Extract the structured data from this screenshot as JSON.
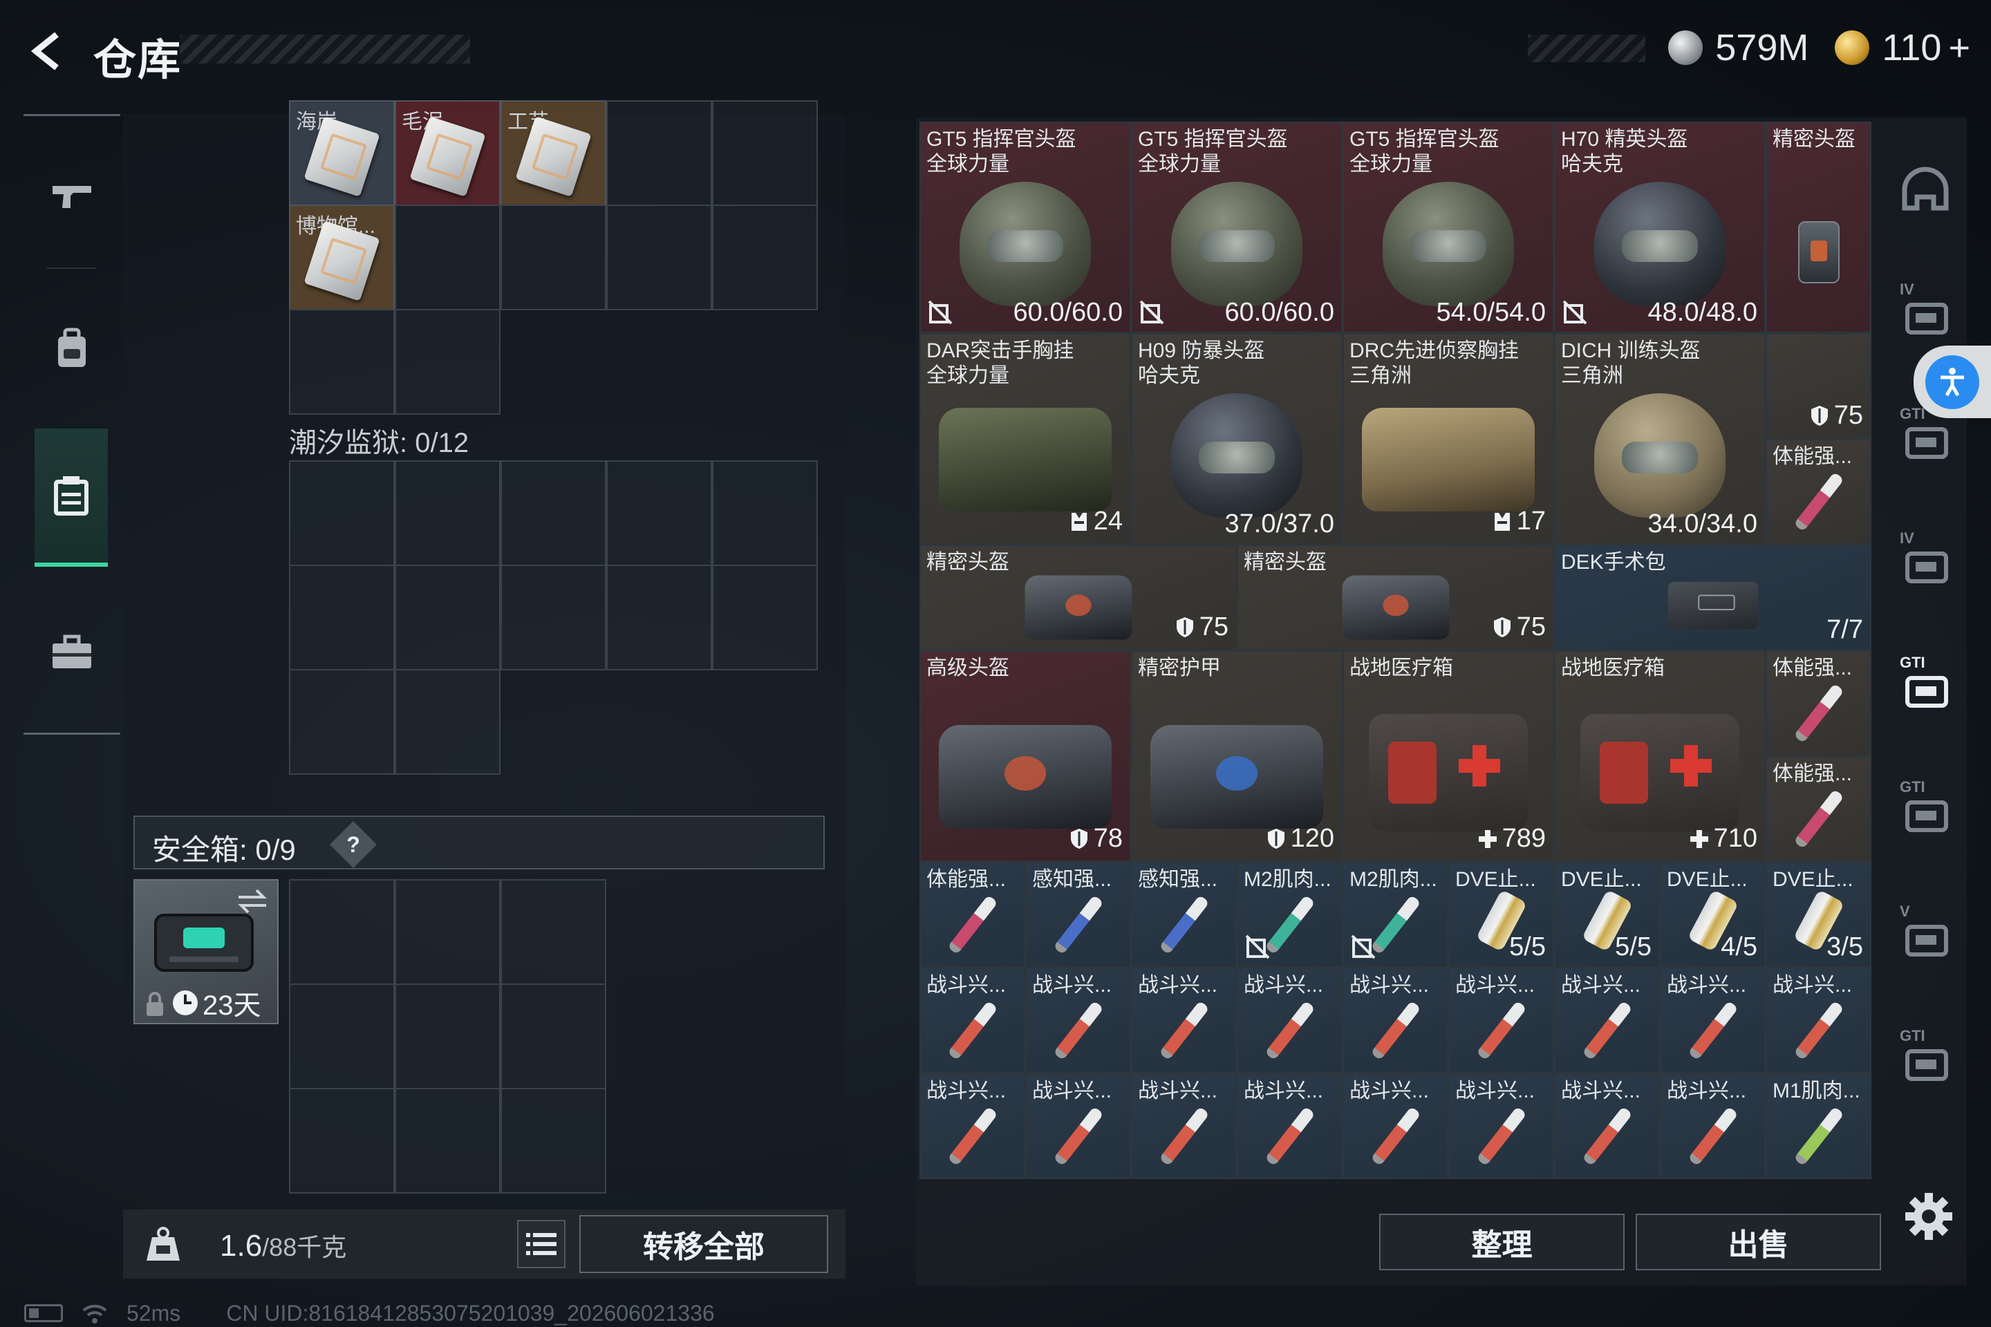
{
  "header": {
    "title": "仓库",
    "currency_silver": "579M",
    "currency_gold": "110",
    "currency_add": "+"
  },
  "left_nav": {
    "items": [
      {
        "name": "weapons",
        "icon": "pistol-icon"
      },
      {
        "name": "equipment",
        "icon": "backpack-icon"
      },
      {
        "name": "storage",
        "icon": "crate-icon",
        "active": true
      },
      {
        "name": "briefcase",
        "icon": "briefcase-icon"
      }
    ]
  },
  "storage": {
    "top_items": [
      {
        "label": "海岸..."
      },
      {
        "label": "毛泥..."
      },
      {
        "label": "工艺..."
      }
    ],
    "museum_item": {
      "label": "博物馆..."
    },
    "prison_label": "潮汐监狱: 0/12"
  },
  "safe_box": {
    "label": "安全箱:  0/9",
    "help": "?",
    "days": "23天"
  },
  "bottom_left": {
    "weight": "1.6",
    "weight_max": "/88千克",
    "transfer_all": "转移全部"
  },
  "inventory": {
    "items": [
      {
        "name": "GT5 指挥官头盔\n全球力量",
        "value": "60.0/60.0",
        "bg": "red",
        "art": "helmet",
        "noicon": true
      },
      {
        "name": "GT5 指挥官头盔\n全球力量",
        "value": "60.0/60.0",
        "bg": "red",
        "art": "helmet",
        "noicon": true
      },
      {
        "name": "GT5 指挥官头盔\n全球力量",
        "value": "54.0/54.0",
        "bg": "red",
        "art": "helmet"
      },
      {
        "name": "H70 精英头盔\n哈夫克",
        "value": "48.0/48.0",
        "bg": "red",
        "art": "helmet dark",
        "noicon": true
      },
      {
        "name": "精密头盔",
        "value": "",
        "bg": "red",
        "art": "vial"
      },
      {
        "name": "DAR突击手胸挂\n全球力量",
        "value": "24",
        "bg": "gray",
        "art": "bag",
        "glyph": "vest"
      },
      {
        "name": "H09 防暴头盔\n哈夫克",
        "value": "37.0/37.0",
        "bg": "gray",
        "art": "helmet dark"
      },
      {
        "name": "DRC先进侦察胸挂\n三角洲",
        "value": "17",
        "bg": "gray",
        "art": "bag tan",
        "glyph": "vest"
      },
      {
        "name": "DICH 训练头盔\n三角洲",
        "value": "34.0/34.0",
        "bg": "gray",
        "art": "helmet tan"
      },
      {
        "name": "",
        "value": "75",
        "bg": "gray",
        "art": "",
        "glyph": "shield"
      },
      {
        "name": "体能强...",
        "value": "",
        "bg": "gray",
        "art": "syringe",
        "sc": "#c84a6e"
      },
      {
        "name": "精密头盔",
        "value": "75",
        "bg": "gray",
        "art": "bag dark",
        "glyph": "shield"
      },
      {
        "name": "精密头盔",
        "value": "75",
        "bg": "gray",
        "art": "bag dark",
        "glyph": "shield"
      },
      {
        "name": "DEK手术包",
        "value": "7/7",
        "bg": "blue",
        "art": "pouch"
      },
      {
        "name": "高级头盔",
        "value": "78",
        "bg": "red",
        "art": "bag dark",
        "glyph": "shield"
      },
      {
        "name": "精密护甲",
        "value": "120",
        "bg": "gray",
        "art": "bag dark blue",
        "glyph": "shield"
      },
      {
        "name": "战地医疗箱",
        "value": "789",
        "bg": "gray",
        "art": "medkit",
        "glyph": "plus"
      },
      {
        "name": "战地医疗箱",
        "value": "710",
        "bg": "gray",
        "art": "medkit",
        "glyph": "plus"
      },
      {
        "name": "体能强...",
        "value": "",
        "bg": "gray",
        "art": "syringe",
        "sc": "#c84a6e"
      },
      {
        "name": "体能强...",
        "value": "",
        "bg": "gray",
        "art": "syringe",
        "sc": "#c84a6e"
      },
      {
        "name": "体能强...",
        "value": "",
        "bg": "blue",
        "art": "syringe",
        "sc": "#c84a6e"
      },
      {
        "name": "感知强...",
        "value": "",
        "bg": "blue",
        "art": "syringe",
        "sc": "#4a6ec8"
      },
      {
        "name": "感知强...",
        "value": "",
        "bg": "blue",
        "art": "syringe",
        "sc": "#4a6ec8"
      },
      {
        "name": "M2肌肉...",
        "value": "",
        "bg": "blue",
        "art": "syringe",
        "sc": "#3fb39a",
        "noicon": true
      },
      {
        "name": "M2肌肉...",
        "value": "",
        "bg": "blue",
        "art": "syringe",
        "sc": "#3fb39a",
        "noicon": true
      },
      {
        "name": "DVE止...",
        "value": "5/5",
        "bg": "blue",
        "art": "can"
      },
      {
        "name": "DVE止...",
        "value": "5/5",
        "bg": "blue",
        "art": "can"
      },
      {
        "name": "DVE止...",
        "value": "4/5",
        "bg": "blue",
        "art": "can"
      },
      {
        "name": "DVE止...",
        "value": "3/5",
        "bg": "blue",
        "art": "can"
      },
      {
        "name": "战斗兴...",
        "value": "",
        "bg": "blue",
        "art": "syringe",
        "sc": "#d65b4a"
      },
      {
        "name": "战斗兴...",
        "value": "",
        "bg": "blue",
        "art": "syringe",
        "sc": "#d65b4a"
      },
      {
        "name": "战斗兴...",
        "value": "",
        "bg": "blue",
        "art": "syringe",
        "sc": "#d65b4a"
      },
      {
        "name": "战斗兴...",
        "value": "",
        "bg": "blue",
        "art": "syringe",
        "sc": "#d65b4a"
      },
      {
        "name": "战斗兴...",
        "value": "",
        "bg": "blue",
        "art": "syringe",
        "sc": "#d65b4a"
      },
      {
        "name": "战斗兴...",
        "value": "",
        "bg": "blue",
        "art": "syringe",
        "sc": "#d65b4a"
      },
      {
        "name": "战斗兴...",
        "value": "",
        "bg": "blue",
        "art": "syringe",
        "sc": "#d65b4a"
      },
      {
        "name": "战斗兴...",
        "value": "",
        "bg": "blue",
        "art": "syringe",
        "sc": "#d65b4a"
      },
      {
        "name": "战斗兴...",
        "value": "",
        "bg": "blue",
        "art": "syringe",
        "sc": "#d65b4a"
      },
      {
        "name": "战斗兴...",
        "value": "",
        "bg": "blue",
        "art": "syringe",
        "sc": "#d65b4a"
      },
      {
        "name": "战斗兴...",
        "value": "",
        "bg": "blue",
        "art": "syringe",
        "sc": "#d65b4a"
      },
      {
        "name": "战斗兴...",
        "value": "",
        "bg": "blue",
        "art": "syringe",
        "sc": "#d65b4a"
      },
      {
        "name": "战斗兴...",
        "value": "",
        "bg": "blue",
        "art": "syringe",
        "sc": "#d65b4a"
      },
      {
        "name": "战斗兴...",
        "value": "",
        "bg": "blue",
        "art": "syringe",
        "sc": "#d65b4a"
      },
      {
        "name": "战斗兴...",
        "value": "",
        "bg": "blue",
        "art": "syringe",
        "sc": "#d65b4a"
      },
      {
        "name": "战斗兴...",
        "value": "",
        "bg": "blue",
        "art": "syringe",
        "sc": "#d65b4a"
      },
      {
        "name": "战斗兴...",
        "value": "",
        "bg": "blue",
        "art": "syringe",
        "sc": "#d65b4a"
      },
      {
        "name": "M1肌肉...",
        "value": "",
        "bg": "blue",
        "art": "syringe",
        "sc": "#9ac85a"
      }
    ]
  },
  "rail": {
    "tabs": [
      {
        "tag": "",
        "icon": "helmet-icon"
      },
      {
        "tag": "IV",
        "icon": "vest-icon"
      },
      {
        "tag": "GTI",
        "icon": "rig-icon"
      },
      {
        "tag": "IV",
        "icon": "backpack-icon"
      },
      {
        "tag": "GTI",
        "icon": "rig-icon"
      },
      {
        "tag": "GTI",
        "icon": "backpack-icon"
      },
      {
        "tag": "V",
        "icon": "backpack-icon"
      },
      {
        "tag": "GTI",
        "icon": "rig-icon"
      }
    ]
  },
  "actions": {
    "sort": "整理",
    "sell": "出售"
  },
  "status": {
    "ping": "52ms",
    "uid": "CN UID:8161841285307520103​9_202606021336"
  }
}
